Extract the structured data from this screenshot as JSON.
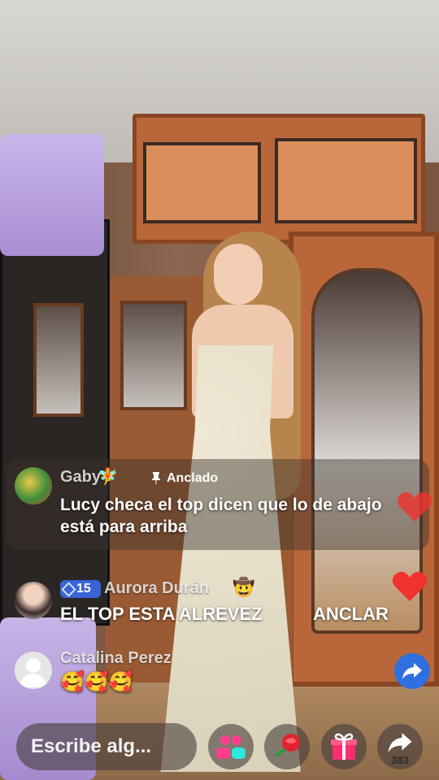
{
  "comments": {
    "pinned": {
      "username": "Gaby",
      "pinned_label": "Anclado",
      "message": "Lucy checa el top dicen que lo de abajo está para arriba"
    },
    "aurora": {
      "level": "15",
      "username": "Aurora Durán",
      "message": "EL TOP ESTA ALREVEZ",
      "action": "ANCLAR"
    },
    "catalina": {
      "username": "Catalina Perez",
      "message": "🥰🥰🥰"
    }
  },
  "bottom_bar": {
    "input_placeholder": "Escribe alg...",
    "share_count": "383"
  },
  "icons": {
    "pinned_icon": "pin-icon",
    "gift_icon": "gift-icon",
    "rose_icon": "rose-icon",
    "guests_icon": "guests-icon",
    "share_icon": "share-icon",
    "heart_icon": "heart-icon"
  },
  "colors": {
    "level_badge": "#3a63d6",
    "heart": "#f0322f",
    "gift": "#ff2d6d",
    "guests": "#ff3f8c",
    "share_fab": "#2f6fe0"
  }
}
